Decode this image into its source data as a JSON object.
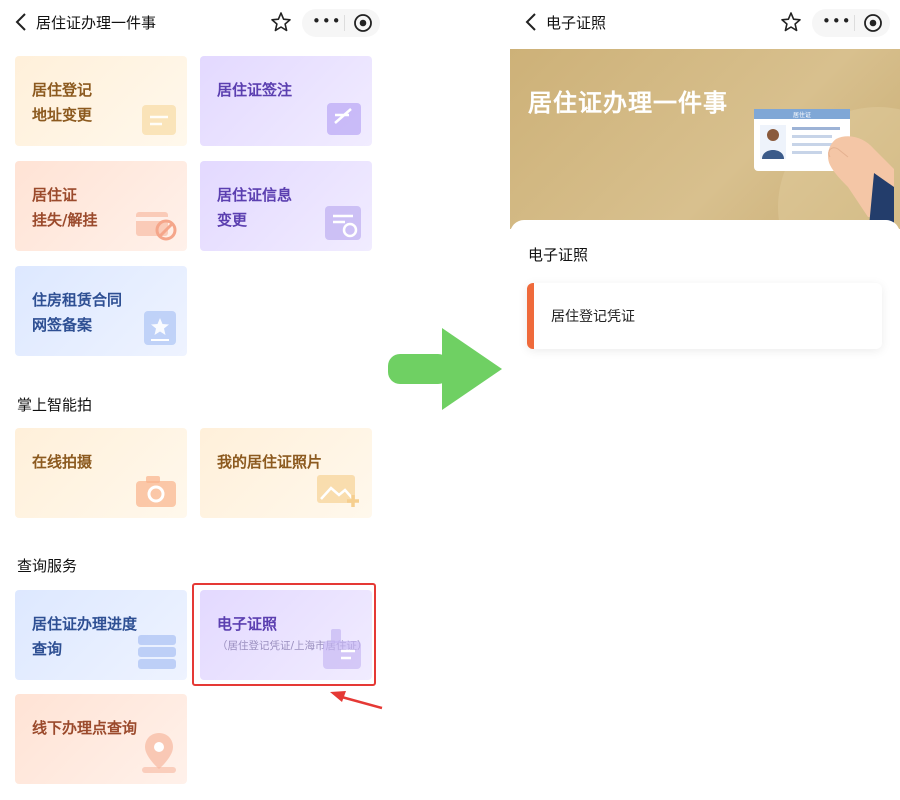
{
  "left": {
    "title": "居住证办理一件事",
    "tiles": [
      {
        "lines": [
          "居住登记",
          "地址变更"
        ]
      },
      {
        "lines": [
          "居住证签注"
        ]
      },
      {
        "lines": [
          "居住证",
          "挂失/解挂"
        ]
      },
      {
        "lines": [
          "居住证信息",
          "变更"
        ]
      },
      {
        "lines": [
          "住房租赁合同",
          "网签备案"
        ]
      }
    ],
    "section_photo": "掌上智能拍",
    "photo_tiles": [
      {
        "lines": [
          "在线拍摄"
        ]
      },
      {
        "lines": [
          "我的居住证照片"
        ]
      }
    ],
    "section_query": "查询服务",
    "query_tiles": [
      {
        "lines": [
          "居住证办理进度",
          "查询"
        ]
      },
      {
        "lines": [
          "电子证照"
        ],
        "sub": "（居住登记凭证/上海市居住证）"
      },
      {
        "lines": [
          "线下办理点查询"
        ]
      }
    ]
  },
  "right": {
    "title": "电子证照",
    "banner_title": "居住证办理一件事",
    "card_text": "居住证",
    "section_title": "电子证照",
    "item": "居住登记凭证"
  },
  "colors": {
    "arrow": "#6fd063",
    "highlight": "#e53935",
    "accent_bar": "#ef6a3b",
    "banner": "#d3b985"
  },
  "icons": [
    "back-icon",
    "star-icon",
    "more-icon",
    "target-icon",
    "camera-icon",
    "location-icon",
    "arrow-right-icon"
  ]
}
